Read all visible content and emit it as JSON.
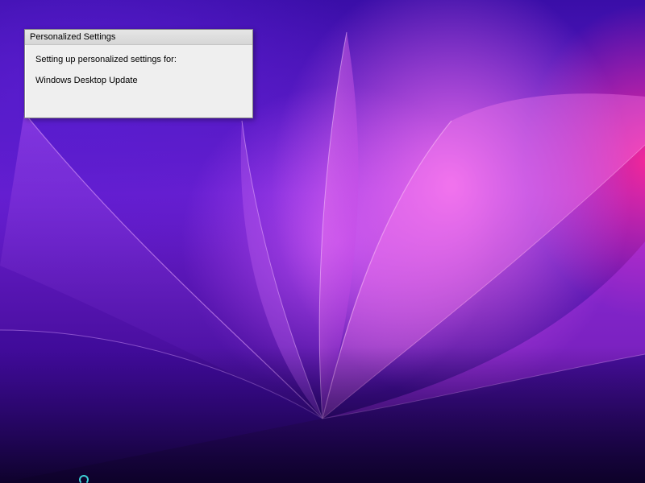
{
  "dialog": {
    "title": "Personalized Settings",
    "message": "Setting up personalized settings for:",
    "component": "Windows Desktop Update"
  },
  "wallpaper": {
    "colors": {
      "deep_violet": "#15033a",
      "purple": "#6a1ed0",
      "magenta": "#ff28a0",
      "pink": "#ff78f0"
    }
  },
  "cursor": {
    "icon": "busy-spinner-icon",
    "color": "#3ed0d8"
  }
}
